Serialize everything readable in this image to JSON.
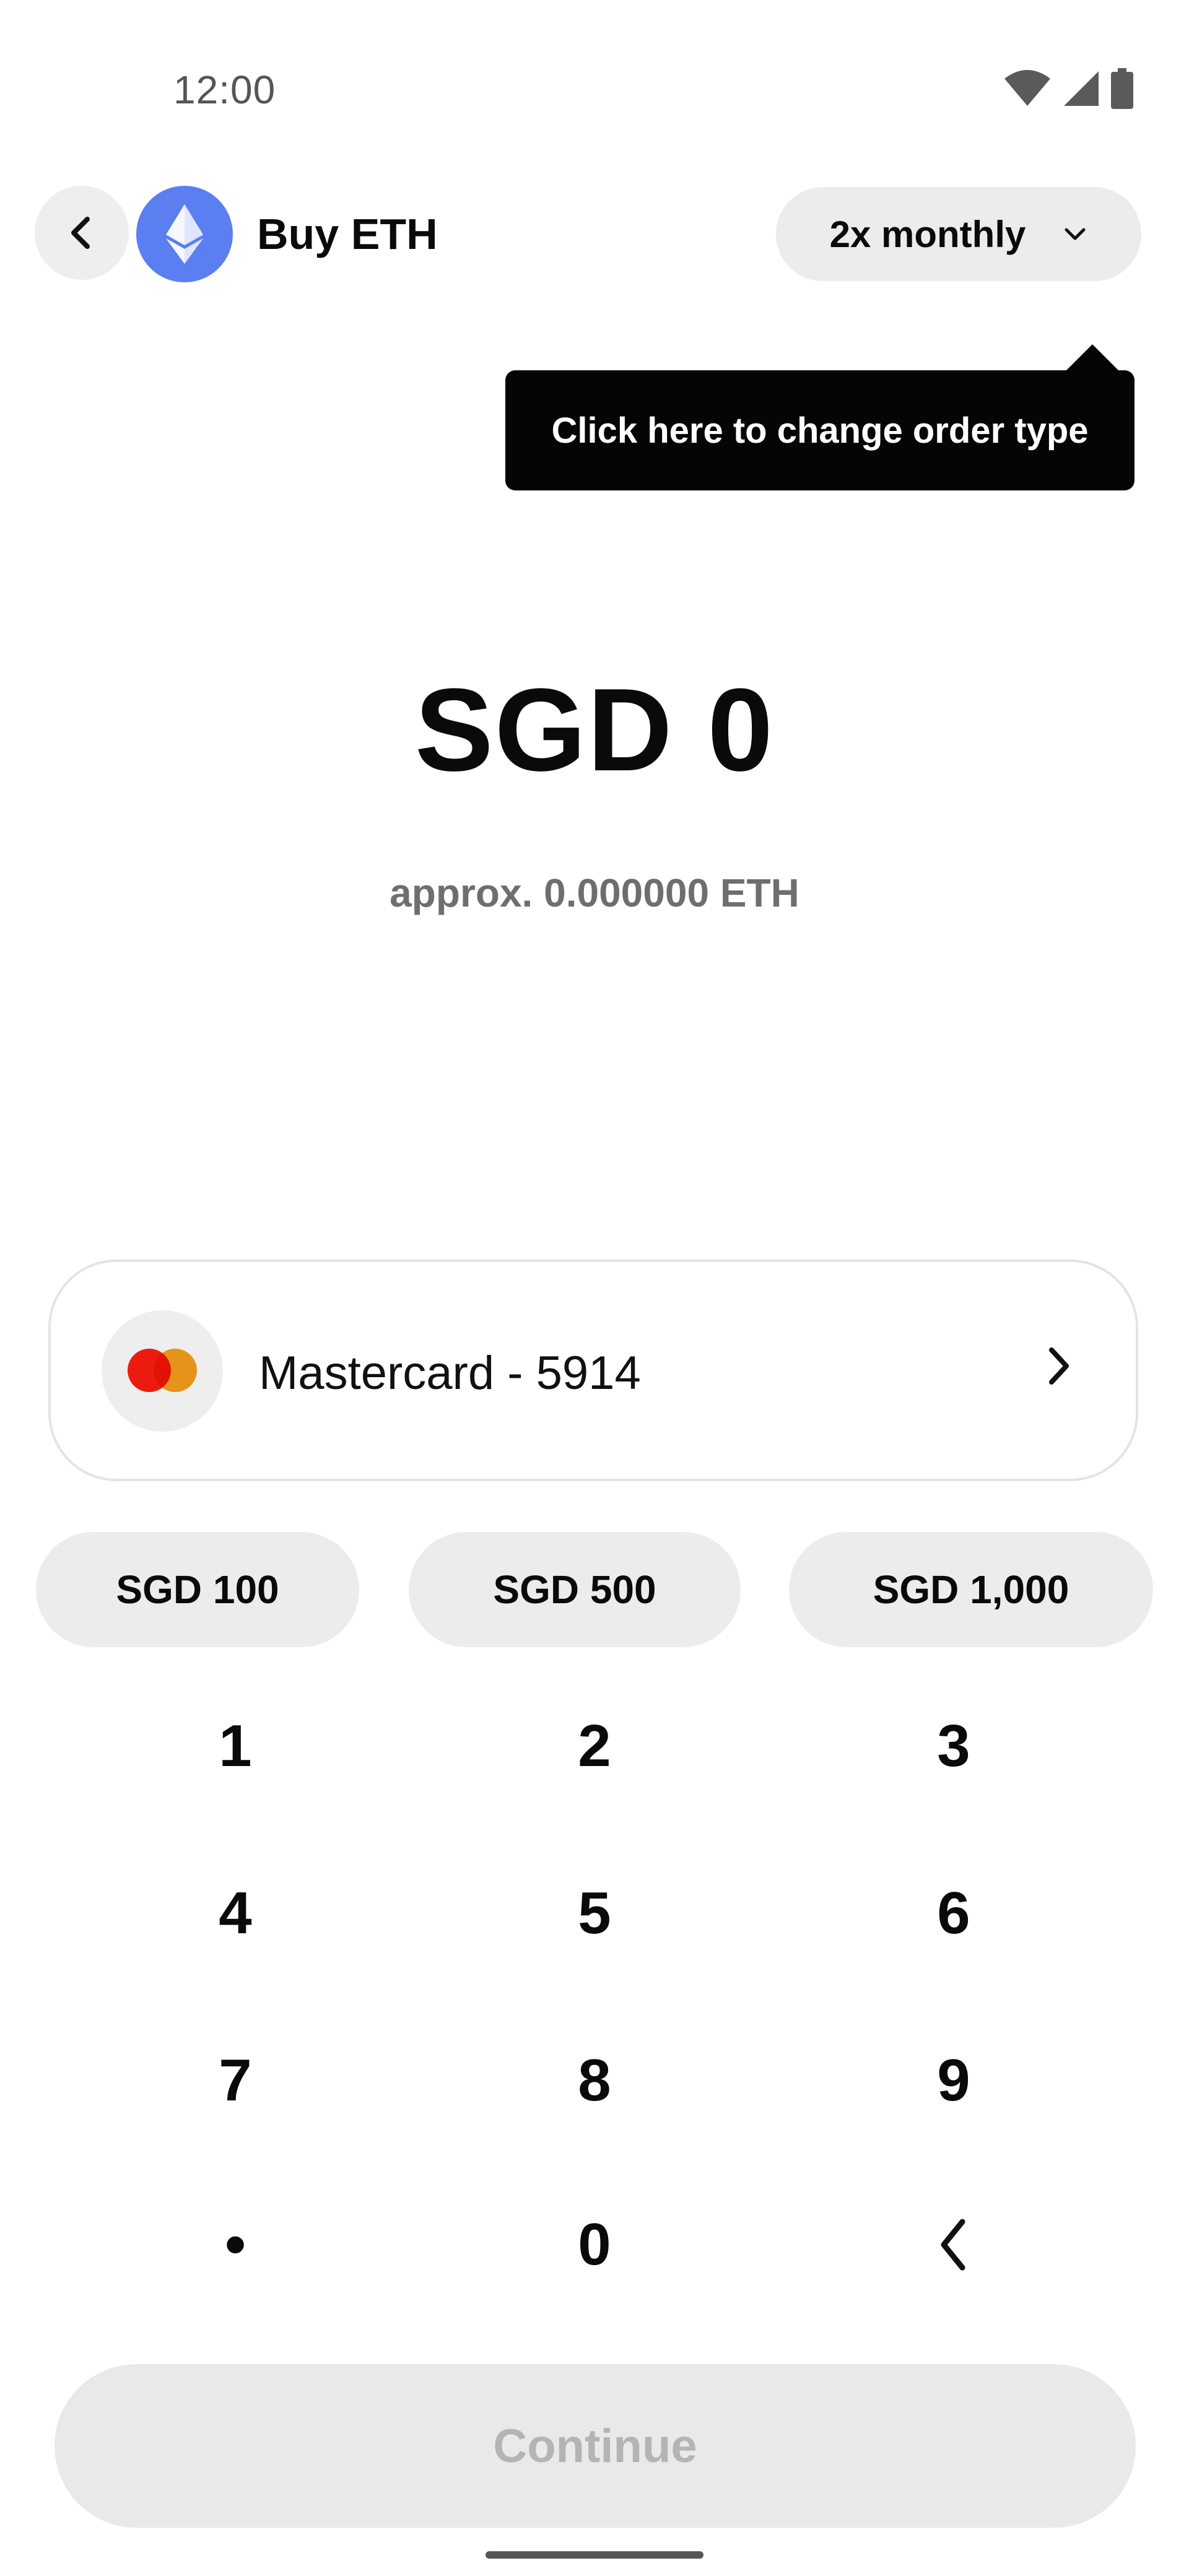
{
  "status_bar": {
    "time": "12:00",
    "icons": [
      "wifi-icon",
      "cell-signal-icon",
      "battery-icon"
    ]
  },
  "header": {
    "back_icon": "chevron-left-icon",
    "asset_icon": "ethereum-icon",
    "title": "Buy ETH",
    "order_type": "2x monthly",
    "order_type_icon": "chevron-down-icon"
  },
  "tooltip": {
    "text": "Click here to change order type"
  },
  "amount": {
    "value": "SGD 0",
    "approx": "approx. 0.000000 ETH"
  },
  "payment": {
    "label": "Mastercard - 5914",
    "icon": "mastercard-icon",
    "chevron_icon": "chevron-right-icon"
  },
  "quick_amounts": [
    "SGD 100",
    "SGD 500",
    "SGD 1,000"
  ],
  "keypad": {
    "keys": [
      "1",
      "2",
      "3",
      "4",
      "5",
      "6",
      "7",
      "8",
      "9",
      "•",
      "0"
    ],
    "backspace_icon": "chevron-left-icon"
  },
  "continue_button": {
    "label": "Continue",
    "state": "disabled"
  },
  "colors": {
    "asset_accent": "#5b7ef0",
    "tooltip_bg": "#050505",
    "pill_bg": "#ececec",
    "mastercard_red": "#eb1c0f",
    "mastercard_orange": "#f79e1b"
  }
}
